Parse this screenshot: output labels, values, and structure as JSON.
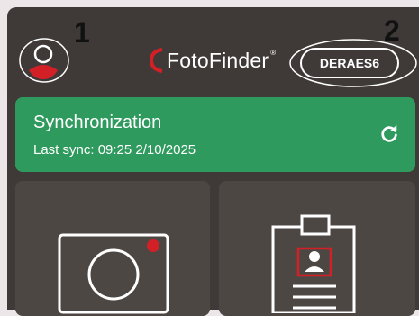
{
  "header": {
    "brand": "FotoFinder",
    "brand_mark": "®",
    "device_label": "DERAES6",
    "avatar_icon": "user-avatar-icon"
  },
  "callouts": [
    "1",
    "2"
  ],
  "sync": {
    "title": "Synchronization",
    "last_sync": "Last sync: 09:25 2/10/2025",
    "icon": "refresh-icon"
  },
  "tiles": [
    {
      "icon": "camera-icon"
    },
    {
      "icon": "patient-clipboard-icon"
    }
  ],
  "colors": {
    "background": "#3f3a38",
    "tile": "#4d4744",
    "accent_red": "#d32027",
    "sync_green": "#2f9a5e"
  }
}
